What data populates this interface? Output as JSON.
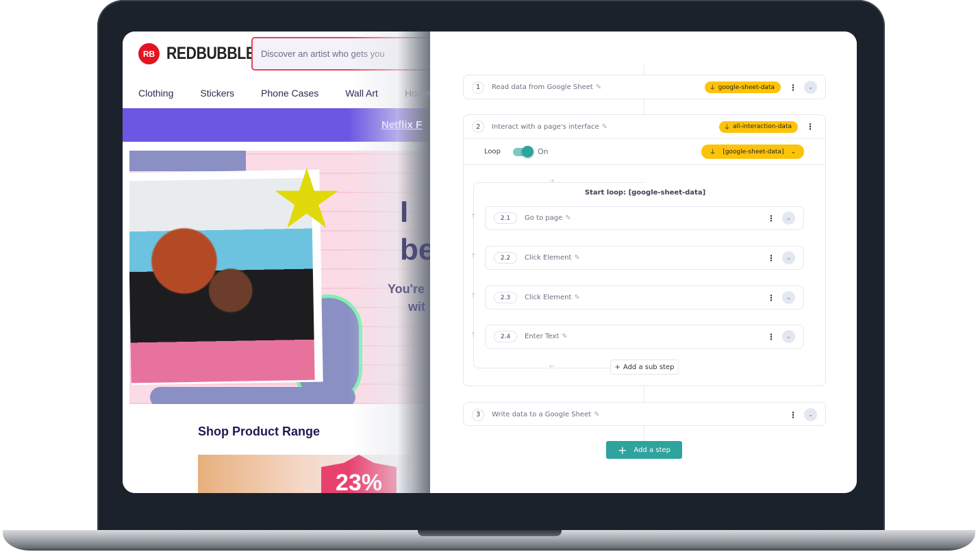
{
  "left_site": {
    "logo_mark": "RB",
    "logo_text": "REDBUBBLE",
    "search_placeholder": "Discover an artist who gets you",
    "nav": [
      "Clothing",
      "Stickers",
      "Phone Cases",
      "Wall Art",
      "Home &"
    ],
    "banner_link": "Netflix F",
    "hero_title_1": "I",
    "hero_title_2": "be",
    "hero_sub_1": "You're",
    "hero_sub_2": "wit",
    "section_title": "Shop Product Range",
    "product_badge": "23%"
  },
  "workflow": {
    "steps": [
      {
        "num": "1",
        "title": "Read data from Google Sheet",
        "chip": "google-sheet-data"
      },
      {
        "num": "2",
        "title": "Interact with a page's interface",
        "chip": "all-interaction-data"
      },
      {
        "num": "3",
        "title": "Write data to a Google Sheet"
      }
    ],
    "loop": {
      "label": "Loop",
      "state": "On",
      "enabled": true,
      "source": "[google-sheet-data]",
      "start_label": "Start loop: [google-sheet-data]"
    },
    "substeps": [
      {
        "num": "2.1",
        "title": "Go to page"
      },
      {
        "num": "2.2",
        "title": "Click Element"
      },
      {
        "num": "2.3",
        "title": "Click Element"
      },
      {
        "num": "2.4",
        "title": "Enter Text"
      }
    ],
    "add_sub_step": "Add a sub step",
    "add_step": "Add a step",
    "colors": {
      "accent": "#2fa39e",
      "chip": "#fcc30b"
    }
  }
}
